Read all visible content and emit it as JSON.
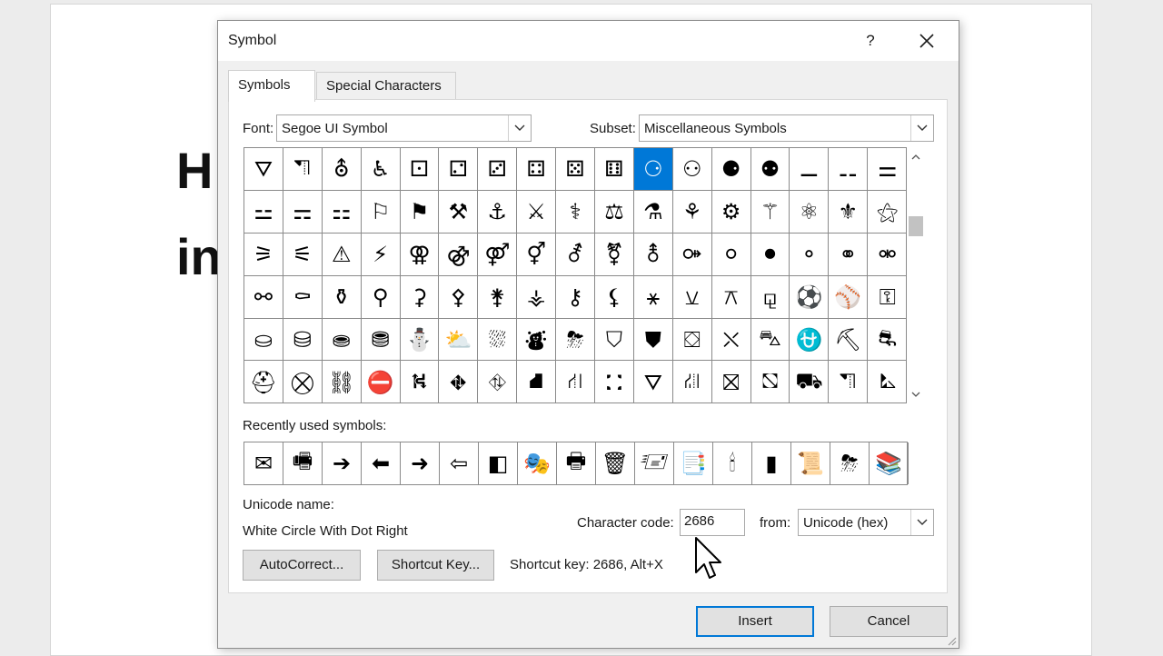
{
  "document": {
    "line1": "H",
    "line2": "in"
  },
  "dialog": {
    "title": "Symbol",
    "help": "?",
    "tabs": [
      "Symbols",
      "Special Characters"
    ],
    "font_label": "Font:",
    "font_value": "Segoe UI Symbol",
    "subset_label": "Subset:",
    "subset_value": "Miscellaneous Symbols",
    "symbols": [
      "⛛",
      "⛠",
      "⛢",
      "♿",
      "⚀",
      "⚁",
      "⚂",
      "⚃",
      "⚄",
      "⚅",
      "⚆",
      "⚇",
      "⚈",
      "⚉",
      "⚊",
      "⚋",
      "⚌",
      "⚍",
      "⚎",
      "⚏",
      "⚐",
      "⚑",
      "⚒",
      "⚓",
      "⚔",
      "⚕",
      "⚖",
      "⚗",
      "⚘",
      "⚙",
      "⚚",
      "⚛",
      "⚜",
      "⚝",
      "⚞",
      "⚟",
      "⚠",
      "⚡",
      "⚢",
      "⚣",
      "⚤",
      "⚥",
      "⚦",
      "⚧",
      "⚨",
      "⚩",
      "⚪",
      "⚫",
      "⚬",
      "⚭",
      "⚮",
      "⚯",
      "⚰",
      "⚱",
      "⚲",
      "⚳",
      "⚴",
      "⚵",
      "⚶",
      "⚷",
      "⚸",
      "⚹",
      "⚺",
      "⚻",
      "⚼",
      "⚽",
      "⚾",
      "⚿",
      "⛀",
      "⛁",
      "⛂",
      "⛃",
      "⛄",
      "⛅",
      "⛆",
      "⛇",
      "⛈",
      "⛉",
      "⛊",
      "⛋",
      "⛌",
      "⛍",
      "⛎",
      "⛏",
      "⛐",
      "⛑",
      "⛒",
      "⛓",
      "⛔",
      "⛕",
      "⛖",
      "⛗",
      "⛘",
      "⛙",
      "⛚",
      "⛛",
      "⛜",
      "⛝",
      "⛞",
      "⛟",
      "⛠",
      "⛡"
    ],
    "selected_index": 10,
    "recent_label": "Recently used symbols:",
    "recent": [
      "✉",
      "🖷",
      "➔",
      "⬅",
      "➜",
      "⇦",
      "◧",
      "🎭",
      "🖶",
      "🗑",
      "🖅",
      "📑",
      "🕯",
      "▮",
      "📜",
      "⛈",
      "📚"
    ],
    "unicode_name_label": "Unicode name:",
    "unicode_name": "White Circle With Dot Right",
    "char_code_label": "Character code:",
    "char_code": "2686",
    "from_label": "from:",
    "from_value": "Unicode (hex)",
    "autocorrect_label": "AutoCorrect...",
    "shortcut_key_label": "Shortcut Key...",
    "shortcut_text": "Shortcut key: 2686, Alt+X",
    "insert_label": "Insert",
    "cancel_label": "Cancel"
  },
  "colors": {
    "selection": "#0078d7",
    "dialog_bg": "#f0f0f0"
  }
}
